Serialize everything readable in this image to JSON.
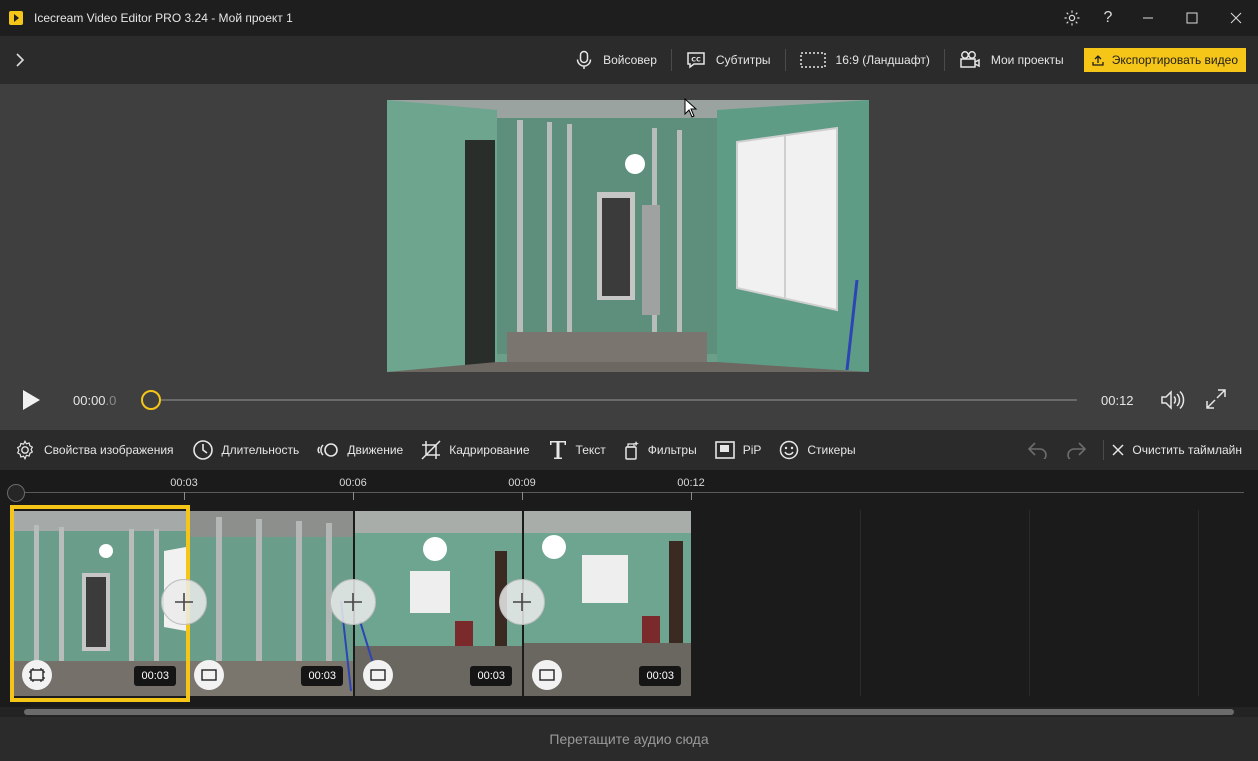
{
  "window": {
    "title": "Icecream Video Editor PRO 3.24   -   Мой проект 1"
  },
  "toolbar": {
    "voiceover": "Войсовер",
    "subtitles": "Субтитры",
    "aspect": "16:9 (Ландшафт)",
    "projects": "Мои проекты",
    "export": "Экспортировать видео"
  },
  "player": {
    "current_time": "00:00",
    "current_frac": ".0",
    "total_time": "00:12",
    "progress": 0
  },
  "edit_tools": [
    {
      "label": "Свойства изображения",
      "icon": "gear-icon"
    },
    {
      "label": "Длительность",
      "icon": "clock-icon"
    },
    {
      "label": "Движение",
      "icon": "motion-icon"
    },
    {
      "label": "Кадрирование",
      "icon": "crop-icon"
    },
    {
      "label": "Текст",
      "icon": "text-icon"
    },
    {
      "label": "Фильтры",
      "icon": "filter-icon"
    },
    {
      "label": "PiP",
      "icon": "pip-icon"
    },
    {
      "label": "Стикеры",
      "icon": "sticker-icon"
    }
  ],
  "edit_right": {
    "clear": "Очистить таймлайн"
  },
  "timeline": {
    "ticks": [
      "00:03",
      "00:06",
      "00:09",
      "00:12"
    ],
    "clips": [
      {
        "duration": "00:03",
        "selected": true
      },
      {
        "duration": "00:03",
        "selected": false
      },
      {
        "duration": "00:03",
        "selected": false
      },
      {
        "duration": "00:03",
        "selected": false
      }
    ]
  },
  "audio": {
    "drop_hint": "Перетащите аудио сюда"
  },
  "colors": {
    "accent": "#f5c518",
    "wall": "#6fa892"
  }
}
